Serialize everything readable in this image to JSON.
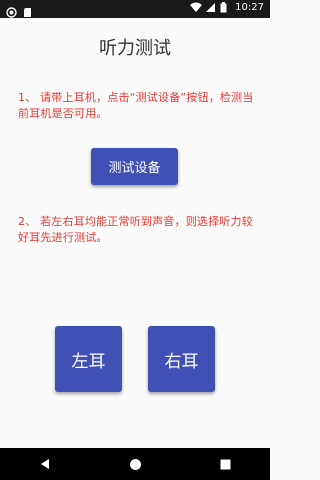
{
  "status_bar": {
    "time": "10:27",
    "left_icons": [
      "notification-icon",
      "sd-card-icon"
    ],
    "right_icons": [
      "wifi-icon",
      "signal-icon",
      "battery-icon"
    ]
  },
  "app": {
    "title": "听力测试",
    "instruction_1": "1、 请带上耳机，点击“测试设备”按钮，检测当前耳机是否可用。",
    "test_button_label": "测试设备",
    "instruction_2": "2、 若左右耳均能正常听到声音，则选择听力较好耳先进行测试。",
    "left_ear_label": "左耳",
    "right_ear_label": "右耳"
  },
  "nav_bar": {
    "buttons": [
      "back-icon",
      "home-icon",
      "recents-icon"
    ]
  },
  "colors": {
    "accent": "#3f51b5",
    "instruction_text": "#e53935",
    "background": "#fafafa"
  }
}
